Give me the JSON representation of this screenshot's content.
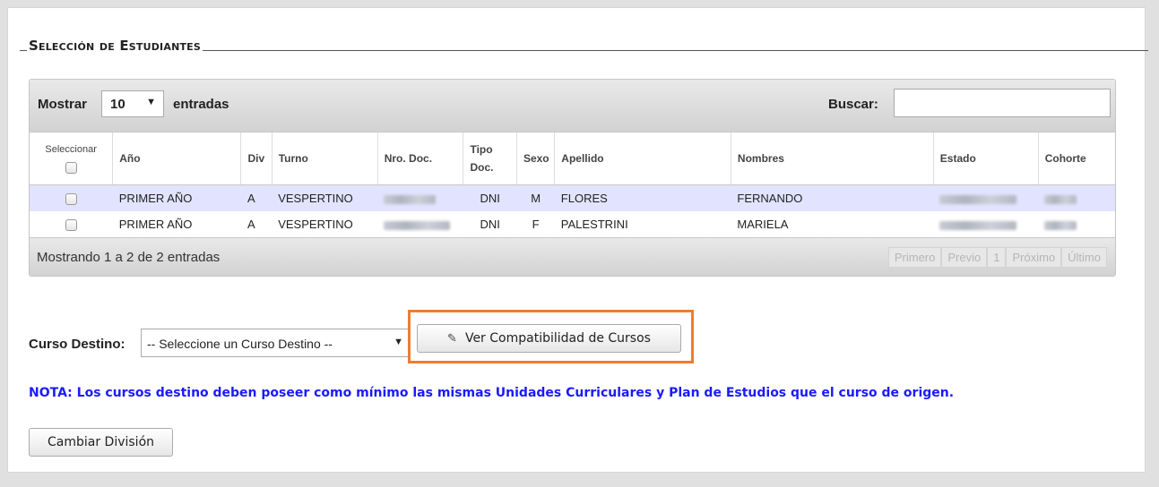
{
  "section_title": "Selección de Estudiantes",
  "table_controls": {
    "show_label": "Mostrar",
    "page_size": "10",
    "entries_label": "entradas",
    "search_label": "Buscar:",
    "search_value": ""
  },
  "columns": {
    "seleccionar": "Seleccionar",
    "anio": "Año",
    "div": "Div",
    "turno": "Turno",
    "nro_doc": "Nro. Doc.",
    "tipo_doc_1": "Tipo",
    "tipo_doc_2": "Doc.",
    "sexo": "Sexo",
    "apellido": "Apellido",
    "nombres": "Nombres",
    "estado": "Estado",
    "cohorte": "Cohorte"
  },
  "rows": [
    {
      "anio": "PRIMER AÑO",
      "div": "A",
      "turno": "VESPERTINO",
      "tipo_doc": "DNI",
      "sexo": "M",
      "apellido": "FLORES",
      "nombres": "FERNANDO"
    },
    {
      "anio": "PRIMER AÑO",
      "div": "A",
      "turno": "VESPERTINO",
      "tipo_doc": "DNI",
      "sexo": "F",
      "apellido": "PALESTRINI",
      "nombres": "MARIELA"
    }
  ],
  "table_info": "Mostrando 1 a 2 de 2 entradas",
  "pagination": {
    "first": "Primero",
    "previous": "Previo",
    "page": "1",
    "next": "Próximo",
    "last": "Último"
  },
  "destination": {
    "label": "Curso Destino:",
    "selected": "-- Seleccione un Curso Destino --"
  },
  "compat_button_label": "Ver Compatibilidad de Cursos",
  "highlight_color": "#ed7d31",
  "note": "NOTA: Los cursos destino deben poseer como mínimo las mismas Unidades Curriculares y Plan de Estudios que el curso de origen.",
  "note_color": "#1a1aff",
  "cambiar_button_label": "Cambiar División"
}
